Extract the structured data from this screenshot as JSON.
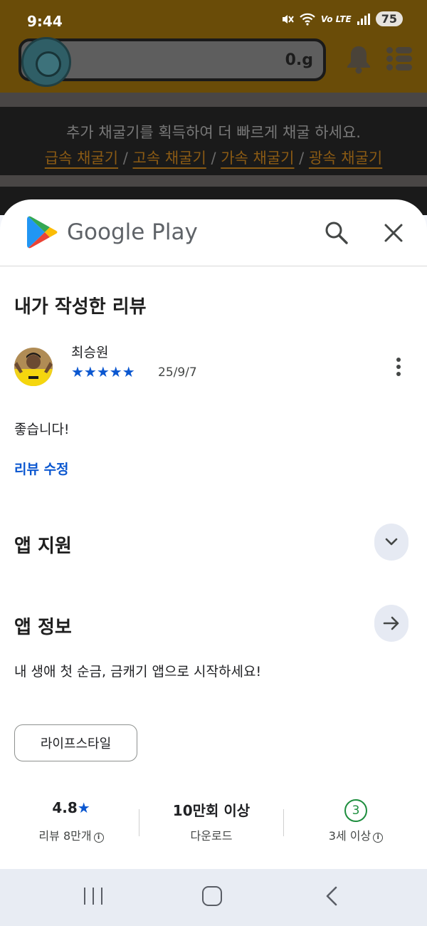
{
  "status_bar": {
    "time": "9:44",
    "network": "Vo LTE",
    "battery": "75",
    "icons": [
      "mute-icon",
      "wifi-icon",
      "signal-icon"
    ]
  },
  "background_app": {
    "gold_amount": "0.g",
    "promo_text": "추가 채굴기를 획득하여 더 빠르게 채굴 하세요.",
    "miners": [
      "급속 채굴기",
      "고속 채굴기",
      "가속 채굴기",
      "광속 채굴기"
    ],
    "separator": " / ",
    "colors": {
      "header": "#6a4c08",
      "promo_bg": "#1a1a1a",
      "link": "#8a5a14"
    }
  },
  "google_play": {
    "brand": "Google Play",
    "my_review": {
      "title": "내가 작성한 리뷰",
      "reviewer": "최승원",
      "rating": 5,
      "stars": "★★★★★",
      "date": "25/9/7",
      "text": "좋습니다!",
      "edit_label": "리뷰 수정"
    },
    "app_support": {
      "title": "앱 지원"
    },
    "app_info": {
      "title": "앱 정보",
      "description": "내 생애 첫 순금, 금캐기 앱으로 시작하세요!",
      "category": "라이프스타일"
    },
    "stats": {
      "rating_value": "4.8",
      "rating_star": "★",
      "reviews_label": "리뷰 8만개",
      "downloads_value": "10만회 이상",
      "downloads_label": "다운로드",
      "age_value": "3",
      "age_label": "3세 이상"
    },
    "colors": {
      "accent": "#0b57d0",
      "age_green": "#1e8e3e"
    }
  },
  "nav_bar": {
    "buttons": [
      "recents-button",
      "home-button",
      "back-button"
    ]
  }
}
